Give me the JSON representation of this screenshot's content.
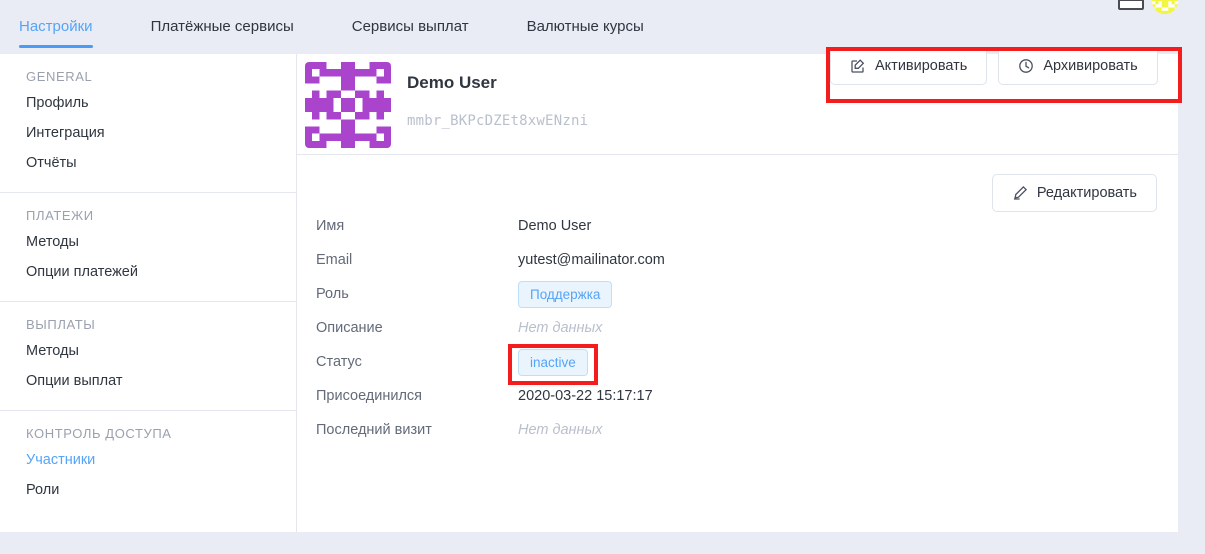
{
  "topbar": {
    "card_icon": "credit-card-icon",
    "avatar_icon": "user-avatar-identicon"
  },
  "tabs": [
    {
      "label": "Настройки",
      "active": true
    },
    {
      "label": "Платёжные сервисы",
      "active": false
    },
    {
      "label": "Сервисы выплат",
      "active": false
    },
    {
      "label": "Валютные курсы",
      "active": false
    }
  ],
  "sidebar": {
    "groups": [
      {
        "title": "GENERAL",
        "items": [
          {
            "label": "Профиль",
            "active": false
          },
          {
            "label": "Интеграция",
            "active": false
          },
          {
            "label": "Отчёты",
            "active": false
          }
        ]
      },
      {
        "title": "ПЛАТЕЖИ",
        "items": [
          {
            "label": "Методы",
            "active": false
          },
          {
            "label": "Опции платежей",
            "active": false
          }
        ]
      },
      {
        "title": "ВЫПЛАТЫ",
        "items": [
          {
            "label": "Методы",
            "active": false
          },
          {
            "label": "Опции выплат",
            "active": false
          }
        ]
      },
      {
        "title": "КОНТРОЛЬ ДОСТУПА",
        "items": [
          {
            "label": "Участники",
            "active": true
          },
          {
            "label": "Роли",
            "active": false
          }
        ]
      }
    ]
  },
  "user": {
    "name": "Demo User",
    "id": "mmbr_BKPcDZEt8xwENzni",
    "avatar_icon": "identicon-avatar"
  },
  "actions": {
    "activate_label": "Активировать",
    "activate_icon": "edit-square-icon",
    "archive_label": "Архивировать",
    "archive_icon": "clock-icon",
    "edit_label": "Редактировать",
    "edit_icon": "pencil-icon"
  },
  "details": [
    {
      "label": "Имя",
      "value": "Demo User",
      "kind": "text"
    },
    {
      "label": "Email",
      "value": "yutest@mailinator.com",
      "kind": "text"
    },
    {
      "label": "Роль",
      "value": "Поддержка",
      "kind": "badge"
    },
    {
      "label": "Описание",
      "value": "Нет данных",
      "kind": "empty"
    },
    {
      "label": "Статус",
      "value": "inactive",
      "kind": "badge"
    },
    {
      "label": "Присоединился",
      "value": "2020-03-22 15:17:17",
      "kind": "text"
    },
    {
      "label": "Последний визит",
      "value": "Нет данных",
      "kind": "empty"
    }
  ],
  "colors": {
    "accent": "#55a4f7",
    "page_bg": "#e9ecf4",
    "card_bg": "#ffffff",
    "border": "#e4e7ee",
    "text": "#2f3640",
    "muted": "#9aa0ae",
    "placeholder": "#b9bfcb",
    "badge_bg": "#eaf4fd",
    "badge_border": "#bfdff9",
    "annotation": "#f41d1d",
    "avatar_purple": "#aa44cc",
    "avatar_yellow": "#f2f542"
  }
}
